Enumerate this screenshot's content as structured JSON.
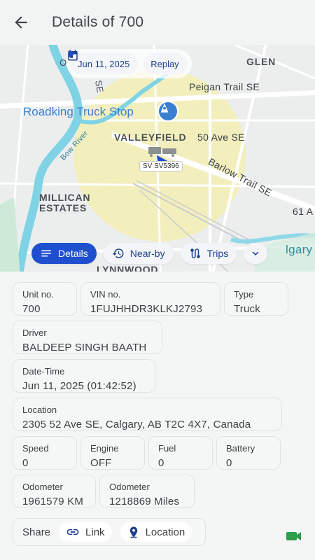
{
  "header": {
    "title": "Details of 700"
  },
  "map": {
    "date_label": "Jun 11, 2025",
    "replay_label": "Replay",
    "poi_name": "Roadking Truck Stop",
    "labels": {
      "valleyfield": "VALLEYFIELD",
      "ave50": "50 Ave SE",
      "peigan": "Peigan Trail SE",
      "barlow": "Barlow Trail SE",
      "millican": "MILLICAN",
      "estates": "ESTATES",
      "lynnwood": "LYNNWOOD",
      "ave61": "61 A",
      "glen": "GLEN",
      "bow_river": "Bow River",
      "calgary": "lgary",
      "se": "SE",
      "o": "O"
    },
    "vehicle_tag": "SV  SV5396"
  },
  "tabs": {
    "details": "Details",
    "nearby": "Near-by",
    "trips": "Trips"
  },
  "details": {
    "unit": {
      "label": "Unit no.",
      "value": "700"
    },
    "vin": {
      "label": "VIN no.",
      "value": "1FUJHHDR3KLKJ2793"
    },
    "type": {
      "label": "Type",
      "value": "Truck"
    },
    "driver": {
      "label": "Driver",
      "value": "BALDEEP SINGH BAATH"
    },
    "datetime": {
      "label": "Date-Time",
      "value": "Jun 11, 2025 (01:42:52)"
    },
    "location": {
      "label": "Location",
      "value": "2305 52 Ave SE, Calgary, AB T2C 4X7, Canada"
    },
    "speed": {
      "label": "Speed",
      "value": "0"
    },
    "engine": {
      "label": "Engine",
      "value": "OFF"
    },
    "fuel": {
      "label": "Fuel",
      "value": "0"
    },
    "battery": {
      "label": "Battery",
      "value": "0"
    },
    "odometer_km": {
      "label": "Odometer",
      "value": "1961579 KM"
    },
    "odometer_miles": {
      "label": "Odometer",
      "value": "1218869 Miles"
    },
    "share": {
      "label": "Share",
      "link": "Link",
      "location": "Location"
    }
  },
  "colors": {
    "accent": "#1f4fcf",
    "geofence": "#f3efb4",
    "river": "#7fd3e4",
    "video_icon": "#2e9e4a"
  }
}
